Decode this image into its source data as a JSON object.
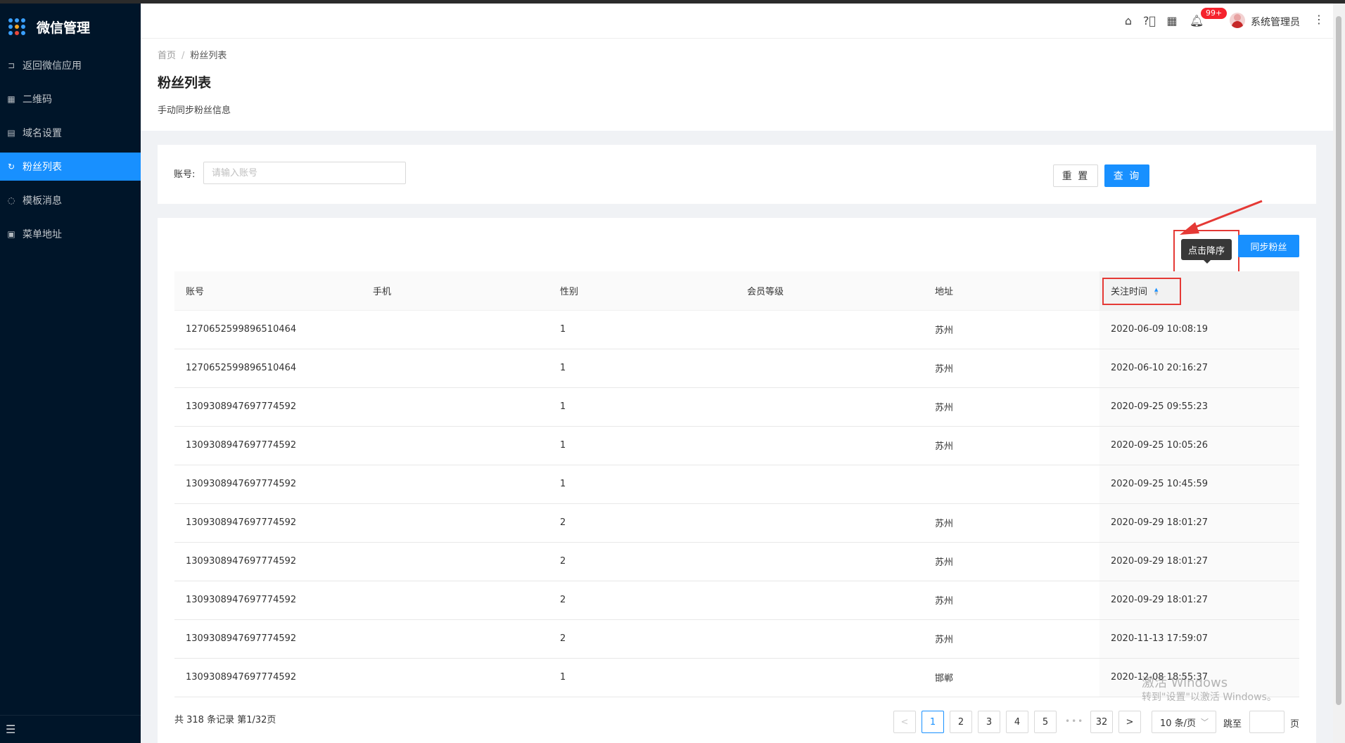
{
  "sidebar": {
    "brand": "微信管理",
    "items": [
      {
        "label": "返回微信应用",
        "icon": "return-icon"
      },
      {
        "label": "二维码",
        "icon": "qrcode-icon"
      },
      {
        "label": "域名设置",
        "icon": "document-icon"
      },
      {
        "label": "粉丝列表",
        "icon": "sync-icon",
        "active": true
      },
      {
        "label": "模板消息",
        "icon": "message-icon"
      },
      {
        "label": "菜单地址",
        "icon": "calendar-icon"
      }
    ]
  },
  "header": {
    "notification_badge": "99+",
    "username": "系统管理员"
  },
  "page": {
    "breadcrumb_home": "首页",
    "breadcrumb_sep": "/",
    "breadcrumb_current": "粉丝列表",
    "title": "粉丝列表",
    "description": "手动同步粉丝信息"
  },
  "search": {
    "label": "账号:",
    "placeholder": "请输入账号",
    "reset_label": "重 置",
    "query_label": "查 询"
  },
  "toolbar": {
    "sync_label": "同步粉丝",
    "tooltip": "点击降序"
  },
  "table": {
    "columns": [
      "账号",
      "手机",
      "性别",
      "会员等级",
      "地址",
      "关注时间"
    ],
    "rows": [
      [
        "1270652599896510464",
        "",
        "1",
        "",
        "苏州",
        "2020-06-09 10:08:19"
      ],
      [
        "1270652599896510464",
        "",
        "1",
        "",
        "苏州",
        "2020-06-10 20:16:27"
      ],
      [
        "1309308947697774592",
        "",
        "1",
        "",
        "苏州",
        "2020-09-25 09:55:23"
      ],
      [
        "1309308947697774592",
        "",
        "1",
        "",
        "苏州",
        "2020-09-25 10:05:26"
      ],
      [
        "1309308947697774592",
        "",
        "1",
        "",
        "",
        "2020-09-25 10:45:59"
      ],
      [
        "1309308947697774592",
        "",
        "2",
        "",
        "苏州",
        "2020-09-29 18:01:27"
      ],
      [
        "1309308947697774592",
        "",
        "2",
        "",
        "苏州",
        "2020-09-29 18:01:27"
      ],
      [
        "1309308947697774592",
        "",
        "2",
        "",
        "苏州",
        "2020-09-29 18:01:27"
      ],
      [
        "1309308947697774592",
        "",
        "2",
        "",
        "苏州",
        "2020-11-13 17:59:07"
      ],
      [
        "1309308947697774592",
        "",
        "1",
        "",
        "邯郸",
        "2020-12-08 18:55:37"
      ]
    ]
  },
  "pagination": {
    "total_text": "共 318 条记录 第1/32页",
    "prev": "<",
    "pages": [
      "1",
      "2",
      "3",
      "4",
      "5"
    ],
    "ellipsis": "•••",
    "last_page": "32",
    "next": ">",
    "page_size": "10 条/页",
    "jump_label": "跳至",
    "page_unit": "页"
  },
  "watermark": {
    "line1": "激活 Windows",
    "line2": "转到\"设置\"以激活 Windows。"
  },
  "colors": {
    "sidebar_bg": "#001529",
    "primary": "#1890ff",
    "annotation": "#e53935"
  }
}
